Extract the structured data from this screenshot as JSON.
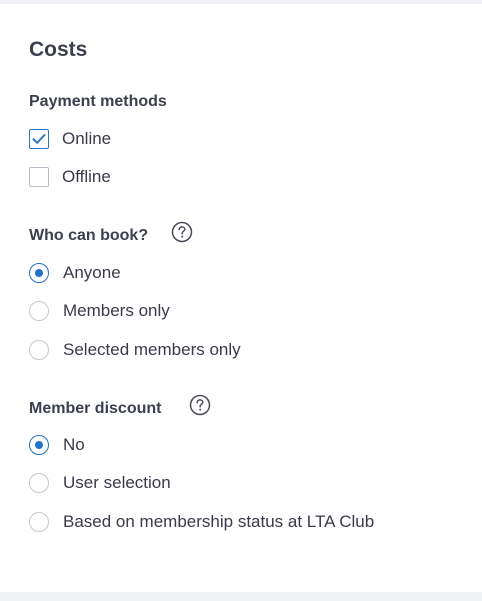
{
  "page": {
    "title": "Costs"
  },
  "payment_methods": {
    "heading": "Payment methods",
    "options": [
      {
        "label": "Online",
        "checked": true
      },
      {
        "label": "Offline",
        "checked": false
      }
    ]
  },
  "who_can_book": {
    "heading": "Who can book?",
    "help_icon": "question-circle-icon",
    "options": [
      {
        "label": "Anyone",
        "selected": true
      },
      {
        "label": "Members only",
        "selected": false
      },
      {
        "label": "Selected members only",
        "selected": false
      }
    ]
  },
  "member_discount": {
    "heading": "Member discount",
    "help_icon": "question-circle-icon",
    "options": [
      {
        "label": "No",
        "selected": true
      },
      {
        "label": "User selection",
        "selected": false
      },
      {
        "label": "Based on membership status at LTA Club",
        "selected": false
      }
    ]
  },
  "colors": {
    "accent": "#1f73c8",
    "text": "#3a3a4a",
    "page_background": "#f0f1f5",
    "panel_background": "#ffffff"
  }
}
